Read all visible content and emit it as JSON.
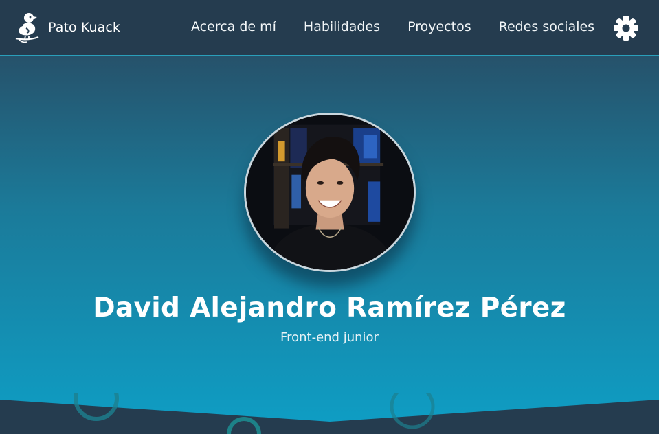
{
  "brand": {
    "name": "Pato Kuack",
    "logo_icon": "duck-logo-icon"
  },
  "nav": {
    "links": [
      "Acerca de mí",
      "Habilidades",
      "Proyectos",
      "Redes sociales"
    ],
    "settings_icon": "gear-icon"
  },
  "hero": {
    "name": "David Alejandro Ramírez Pérez",
    "role": "Front-end junior"
  },
  "colors": {
    "navbar": "#253c4f",
    "accent": "#2a9fba",
    "hero_top": "#26526b",
    "hero_bottom": "#0e9fc6"
  }
}
